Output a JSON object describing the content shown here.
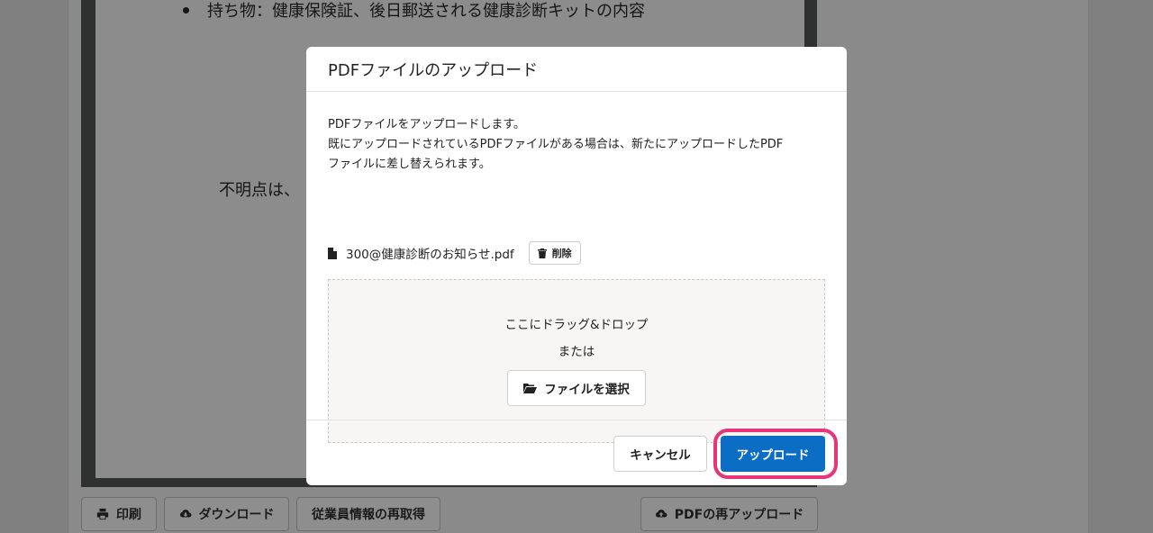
{
  "background": {
    "doc_bullet_text": "持ち物：健康保険証、後日郵送される健康診断キットの内容",
    "doc_line_text": "不明点は、",
    "buttons": {
      "print_label": "印刷",
      "download_label": "ダウンロード",
      "refetch_label": "従業員情報の再取得",
      "reupload_label": "PDFの再アップロード"
    }
  },
  "modal": {
    "title": "PDFファイルのアップロード",
    "description": [
      "PDFファイルをアップロードします。",
      "既にアップロードされているPDFファイルがある場合は、新たにアップロードしたPDF",
      "ファイルに差し替えられます。"
    ],
    "file": {
      "name": "300@健康診断のお知らせ.pdf",
      "delete_label": "削除"
    },
    "dropzone": {
      "drag_text": "ここにドラッグ&ドロップ",
      "or_text": "または",
      "select_label": "ファイルを選択"
    },
    "footer": {
      "cancel_label": "キャンセル",
      "upload_label": "アップロード"
    }
  },
  "colors": {
    "primary": "#0c6dc5",
    "highlight": "#e8357a",
    "overlay_bg": "#808080"
  },
  "icons": [
    "print-icon",
    "cloud-download-icon",
    "cloud-upload-icon",
    "file-icon",
    "trash-icon",
    "folder-open-icon"
  ]
}
